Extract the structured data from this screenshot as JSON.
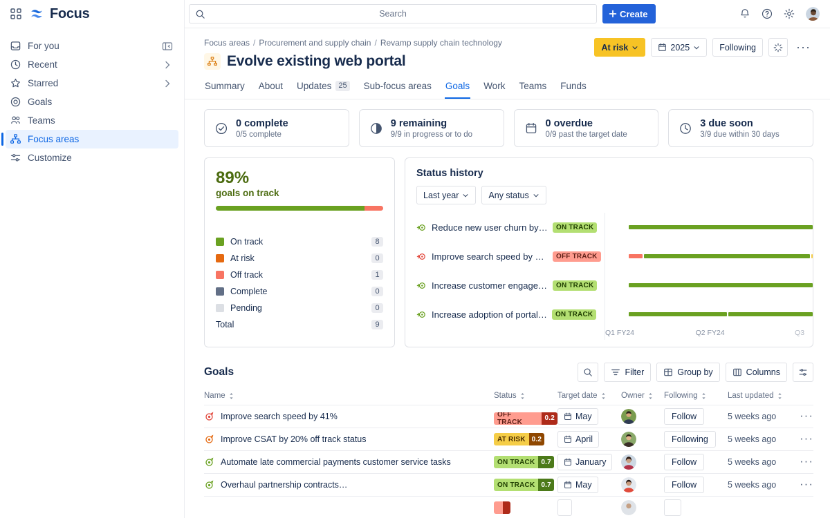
{
  "app": {
    "brand": "Focus",
    "brand_color": "#1868db"
  },
  "topbar": {
    "search_placeholder": "Search",
    "search_value": "",
    "create_label": "Create",
    "icons": [
      "notification-bell-icon",
      "help-icon",
      "settings-gear-icon",
      "user-avatar"
    ]
  },
  "sidebar": {
    "items": [
      {
        "label": "For you",
        "icon": "inbox-icon",
        "right": "collapse-panel-icon",
        "active": false
      },
      {
        "label": "Recent",
        "icon": "clock-icon",
        "right": "chevron-right-icon",
        "active": false
      },
      {
        "label": "Starred",
        "icon": "star-icon",
        "right": "chevron-right-icon",
        "active": false
      },
      {
        "label": "Goals",
        "icon": "target-icon",
        "right": "",
        "active": false
      },
      {
        "label": "Teams",
        "icon": "people-icon",
        "right": "",
        "active": false
      },
      {
        "label": "Focus areas",
        "icon": "hierarchy-icon",
        "right": "",
        "active": true
      },
      {
        "label": "Customize",
        "icon": "sliders-icon",
        "right": "",
        "active": false
      }
    ]
  },
  "page": {
    "breadcrumb": [
      "Focus areas",
      "Procurement and supply chain",
      "Revamp supply chain technology"
    ],
    "title": "Evolve existing web portal",
    "title_icon": "focus-area-icon",
    "actions": {
      "status": "At risk",
      "year": "2025",
      "following": "Following",
      "ai_icon": "sparkle-ai-icon",
      "more": "···"
    },
    "tabs": [
      {
        "label": "Summary",
        "count": "",
        "active": false
      },
      {
        "label": "About",
        "count": "",
        "active": false
      },
      {
        "label": "Updates",
        "count": "25",
        "active": false
      },
      {
        "label": "Sub-focus areas",
        "count": "",
        "active": false
      },
      {
        "label": "Goals",
        "count": "",
        "active": true
      },
      {
        "label": "Work",
        "count": "",
        "active": false
      },
      {
        "label": "Teams",
        "count": "",
        "active": false
      },
      {
        "label": "Funds",
        "count": "",
        "active": false
      }
    ]
  },
  "stats": [
    {
      "icon": "check-circle-icon",
      "value": "0 complete",
      "sub": "0/5 complete"
    },
    {
      "icon": "pie-chart-icon",
      "value": "9 remaining",
      "sub": "9/9 in progress or to do"
    },
    {
      "icon": "calendar-icon",
      "value": "0 overdue",
      "sub": "0/9 past the target date"
    },
    {
      "icon": "clock-icon",
      "value": "3 due soon",
      "sub": "3/9 due within 30 days"
    }
  ],
  "on_track_panel": {
    "percent": "89%",
    "caption": "goals on track",
    "total_label": "Total",
    "total_value": "9"
  },
  "status_history": {
    "title": "Status history",
    "filter_period": "Last year",
    "filter_status": "Any status",
    "rows": [
      {
        "name": "Reduce new user churn by 1…",
        "status": "ON TRACK",
        "status_key": "on"
      },
      {
        "name": "Improve search speed by 4…",
        "status": "OFF TRACK",
        "status_key": "off"
      },
      {
        "name": "Increase customer engagem…",
        "status": "ON TRACK",
        "status_key": "on"
      },
      {
        "name": "Increase adoption of portal…",
        "status": "ON TRACK",
        "status_key": "on"
      }
    ],
    "axis_labels": [
      "Q1  FY24",
      "Q2  FY24",
      "Q3"
    ]
  },
  "goals_section": {
    "title": "Goals",
    "tools": [
      {
        "label": "",
        "icon": "search-icon"
      },
      {
        "label": "Filter",
        "icon": "filter-icon"
      },
      {
        "label": "Group by",
        "icon": "group-icon"
      },
      {
        "label": "Columns",
        "icon": "columns-icon"
      },
      {
        "label": "",
        "icon": "settings-sliders-icon"
      }
    ],
    "columns": [
      "Name",
      "Status",
      "Target date",
      "Owner",
      "Following",
      "Last updated"
    ],
    "rows": [
      {
        "name": "Improve search speed by 41%",
        "status_label": "OFF TRACK",
        "status_value": "0.2",
        "status_key": "off",
        "target_date": "May",
        "follow": "Follow",
        "updated": "5 weeks ago"
      },
      {
        "name": "Improve CSAT by 20% off track status",
        "status_label": "AT RISK",
        "status_value": "0.2",
        "status_key": "risk",
        "target_date": "April",
        "follow": "Following",
        "updated": "5 weeks ago"
      },
      {
        "name": "Automate late commercial payments customer service tasks",
        "status_label": "ON TRACK",
        "status_value": "0.7",
        "status_key": "on",
        "target_date": "January",
        "follow": "Follow",
        "updated": "5 weeks ago"
      },
      {
        "name": "Overhaul partnership contracts…",
        "status_label": "ON TRACK",
        "status_value": "0.7",
        "status_key": "on",
        "target_date": "May",
        "follow": "Follow",
        "updated": "5 weeks ago"
      }
    ]
  },
  "chart_data": [
    {
      "type": "bar",
      "title": "89% goals on track",
      "subtype": "stacked-progress",
      "categories": [
        "On track",
        "At risk",
        "Off track",
        "Complete",
        "Pending"
      ],
      "values": [
        8,
        0,
        1,
        0,
        0
      ],
      "colors": [
        "#6aa121",
        "#e56910",
        "#f87462",
        "#626f86",
        "#dcdfe4"
      ],
      "total": 9,
      "percent_on_track": 89,
      "bar_segments": [
        {
          "label": "On track",
          "fraction": 0.889,
          "color": "#6aa121"
        },
        {
          "label": "Off track",
          "fraction": 0.111,
          "color": "#f87462"
        }
      ],
      "legend": "inline-list",
      "grid": false
    },
    {
      "type": "bar",
      "subtype": "timeline-status-history",
      "title": "Status history",
      "xlabel": "",
      "ylabel": "",
      "x_ticks": [
        "Q1 FY24",
        "Q2 FY24",
        "Q3"
      ],
      "grid": false,
      "legend": "none",
      "series": [
        {
          "name": "Reduce new user churn by 1…",
          "current_status": "ON TRACK",
          "segments": [
            {
              "status": "on track",
              "color": "#6aa121",
              "start": 0.0,
              "end": 1.0
            }
          ]
        },
        {
          "name": "Improve search speed by 4…",
          "current_status": "OFF TRACK",
          "segments": [
            {
              "status": "off track",
              "color": "#f87462",
              "start": 0.0,
              "end": 0.075
            },
            {
              "status": "on track",
              "color": "#6aa121",
              "start": 0.085,
              "end": 0.985
            },
            {
              "status": "pending",
              "color": "#f9e0a8",
              "start": 0.99,
              "end": 1.0
            }
          ]
        },
        {
          "name": "Increase customer engagem…",
          "current_status": "ON TRACK",
          "segments": [
            {
              "status": "on track",
              "color": "#6aa121",
              "start": 0.0,
              "end": 1.0
            }
          ]
        },
        {
          "name": "Increase adoption of portal…",
          "current_status": "ON TRACK",
          "segments": [
            {
              "status": "on track",
              "color": "#6aa121",
              "start": 0.0,
              "end": 0.535
            },
            {
              "status": "on track",
              "color": "#6aa121",
              "start": 0.545,
              "end": 1.0
            }
          ]
        }
      ]
    }
  ],
  "legend_rows": [
    {
      "label": "On track",
      "value": "8",
      "color": "#6aa121"
    },
    {
      "label": "At risk",
      "value": "0",
      "color": "#e56910"
    },
    {
      "label": "Off track",
      "value": "1",
      "color": "#f87462"
    },
    {
      "label": "Complete",
      "value": "0",
      "color": "#626f86"
    },
    {
      "label": "Pending",
      "value": "0",
      "color": "#dcdfe4"
    }
  ]
}
